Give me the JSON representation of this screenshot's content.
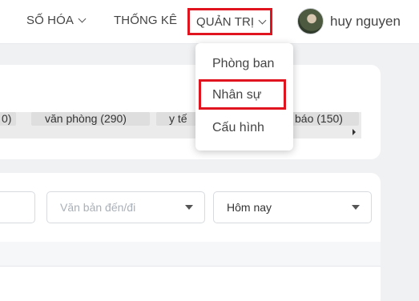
{
  "nav": {
    "items": [
      {
        "label": "SỐ HÓA",
        "icon": "chevron-down-icon"
      },
      {
        "label": "THỐNG KÊ"
      },
      {
        "label": "QUẢN TRỊ",
        "icon": "chevron-down-icon",
        "highlight_color": "#e0141e"
      }
    ],
    "user": {
      "name": "huy nguyen",
      "avatar": "avatar-image"
    }
  },
  "tags": [
    {
      "label": "0)"
    },
    {
      "label": "văn phòng  (290)"
    },
    {
      "label": "y tế"
    },
    {
      "label": "báo  (150)"
    }
  ],
  "filters": {
    "doc_type": {
      "placeholder": "Văn bản đến/đi"
    },
    "date_range": {
      "value": "Hôm nay"
    }
  },
  "dropdown": {
    "items": [
      {
        "label": "Phòng ban"
      },
      {
        "label": "Nhân sự",
        "highlighted": true
      },
      {
        "label": "Cấu hình"
      }
    ]
  },
  "colors": {
    "highlight": "#e0141e",
    "background": "#f0f1f3",
    "card": "#ffffff"
  }
}
